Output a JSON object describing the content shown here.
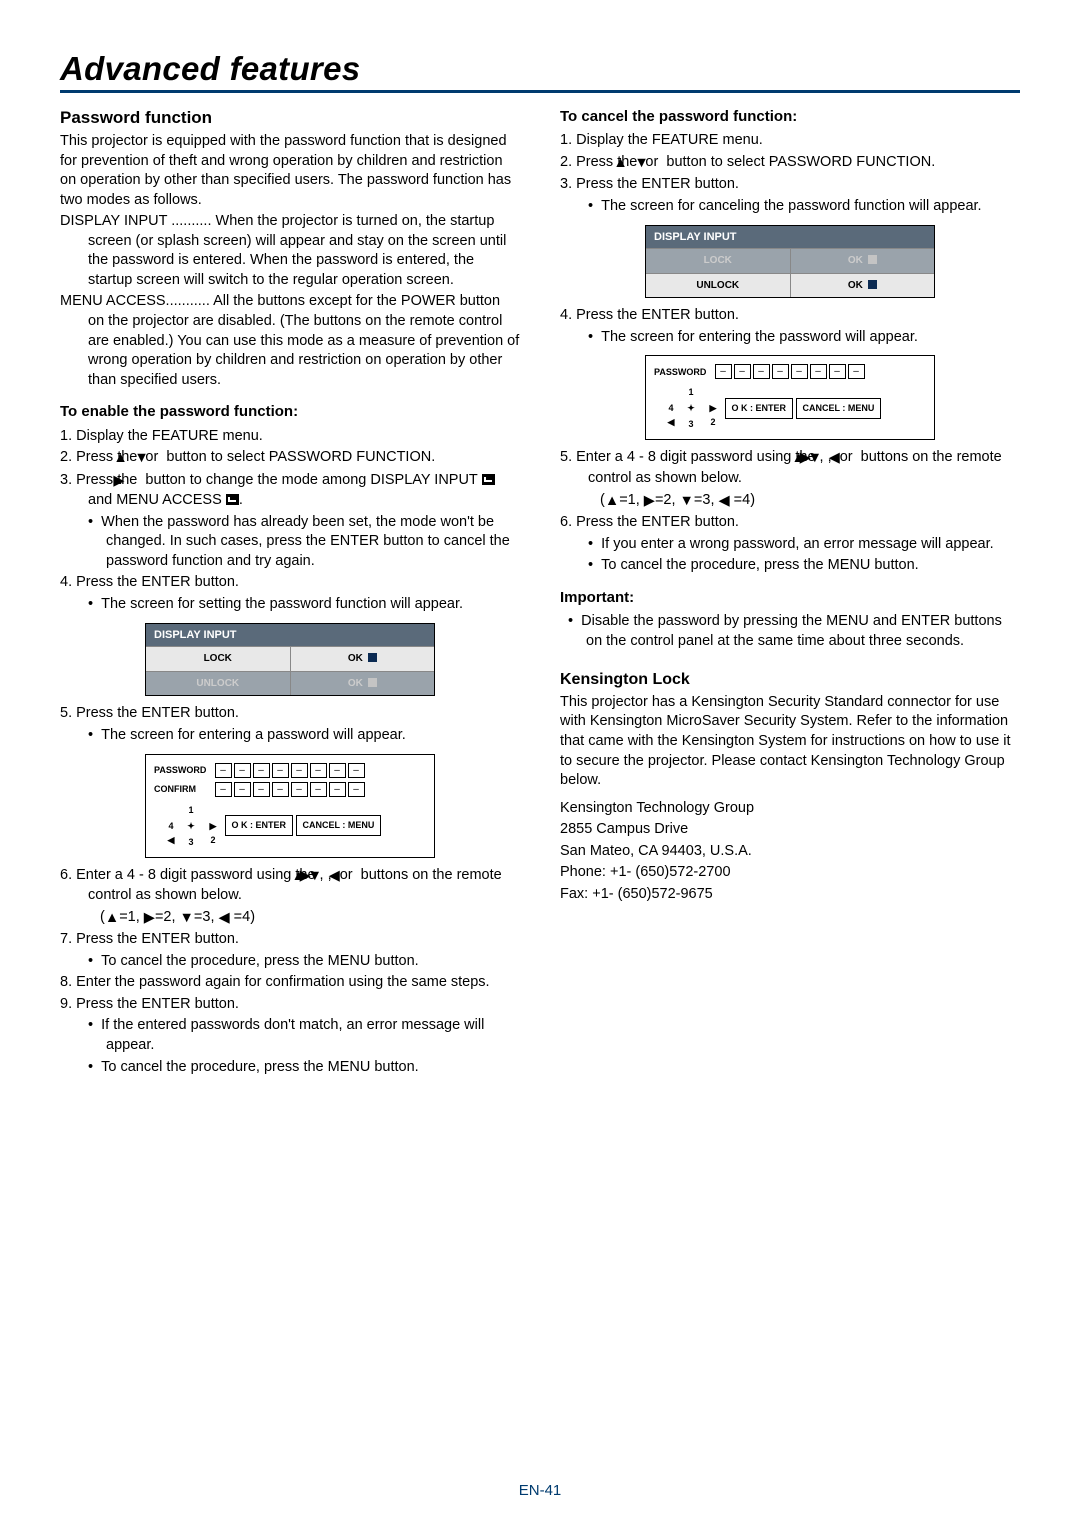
{
  "title": "Advanced features",
  "left": {
    "h_pwd": "Password function",
    "intro": "This projector is equipped with the password function that is designed for prevention of theft and wrong operation by children and restriction on operation by other than specified users. The password function has two modes as follows.",
    "di": "DISPLAY INPUT .......... When the projector is turned on, the startup screen (or splash screen) will appear and stay on the screen until the password is entered. When the password is entered, the startup screen will switch to the regular operation screen.",
    "ma": "MENU ACCESS........... All the buttons except for the POWER button on the projector are disabled. (The buttons on the remote control are enabled.) You can use this mode as a measure of prevention of wrong operation by children and restriction on operation by other than specified users.",
    "h_enable": "To enable the password function:",
    "s1": "1.  Display the FEATURE menu.",
    "s2a": "2.  Press the ",
    "s2b": " or ",
    "s2c": " button to select PASSWORD FUNCTION.",
    "s3a": "3.  Press the ",
    "s3b": " button to change the mode among DISPLAY INPUT ",
    "s3c": " and MENU ACCESS ",
    "s3d": ".",
    "s3bul": "When the password has already been set, the mode won't be changed. In such cases, press the ENTER button to cancel the password function and try again.",
    "s4": "4.  Press the ENTER button.",
    "s4bul": "The screen for setting the password function will appear.",
    "s5": "5.  Press the ENTER button.",
    "s5bul": "The screen for entering a password will appear.",
    "s6a": "6.  Enter a 4 - 8 digit password using the ",
    "s6b": " buttons on the remote control as shown below.",
    "s6map": "=1,  ",
    "s6map2": "=2,  ",
    "s6map3": "=3,  ",
    "s6map4": " =4)",
    "s7": "7.  Press the ENTER button.",
    "s7bul": "To cancel the procedure, press the MENU button.",
    "s8": "8.  Enter the password again for confirmation using the same steps.",
    "s9": "9.  Press the ENTER button.",
    "s9b1": "If the entered passwords don't match, an error message will appear.",
    "s9b2": "To cancel the procedure, press the MENU button."
  },
  "right": {
    "h_cancel": "To cancel the password function:",
    "c1": "1.  Display the FEATURE menu.",
    "c2a": "2.  Press the ",
    "c2b": " or ",
    "c2c": " button to select PASSWORD FUNCTION.",
    "c3": "3.  Press the ENTER button.",
    "c3bul": "The screen for canceling the password function will appear.",
    "c4": "4.  Press the ENTER button.",
    "c4bul": "The screen for entering the password will appear.",
    "c5a": "5.  Enter a 4 - 8 digit password using the ",
    "c5b": " buttons on the remote control as shown below.",
    "c5map": "=1,  ",
    "c5map2": "=2,  ",
    "c5map3": "=3,  ",
    "c5map4": " =4)",
    "c6": "6.  Press the ENTER button.",
    "c6b1": "If you enter a wrong password, an error message will appear.",
    "c6b2": "To cancel the procedure, press the MENU button.",
    "h_imp": "Important:",
    "imp1": "Disable the password by pressing the MENU and ENTER buttons on the control panel at the same time about three seconds.",
    "h_kens": "Kensington Lock",
    "kens_p": "This projector has a Kensington Security Standard connector for use with Kensington MicroSaver Security System. Refer to the information that came with the Kensington System for instructions on how to use it to secure the projector. Please contact Kensington Technology Group below.",
    "kaddr1": "Kensington Technology Group",
    "kaddr2": "2855 Campus Drive",
    "kaddr3": "San Mateo, CA 94403, U.S.A.",
    "kaddr4": "Phone: +1- (650)572-2700",
    "kaddr5": "Fax: +1- (650)572-9675"
  },
  "osd": {
    "header": "DISPLAY INPUT",
    "lock": "LOCK",
    "unlock": "UNLOCK",
    "ok": "OK",
    "password": "PASSWORD",
    "confirm": "CONFIRM",
    "dash": "–",
    "ok_enter": "O K : ENTER",
    "cancel_menu": "CANCEL : MENU",
    "d1": "1",
    "d2": "2",
    "d3": "3",
    "d4": "4"
  },
  "tri": {
    "up": "▲",
    "down": "▼",
    "left": "◀",
    "right": "▶"
  },
  "footer": "EN-41"
}
